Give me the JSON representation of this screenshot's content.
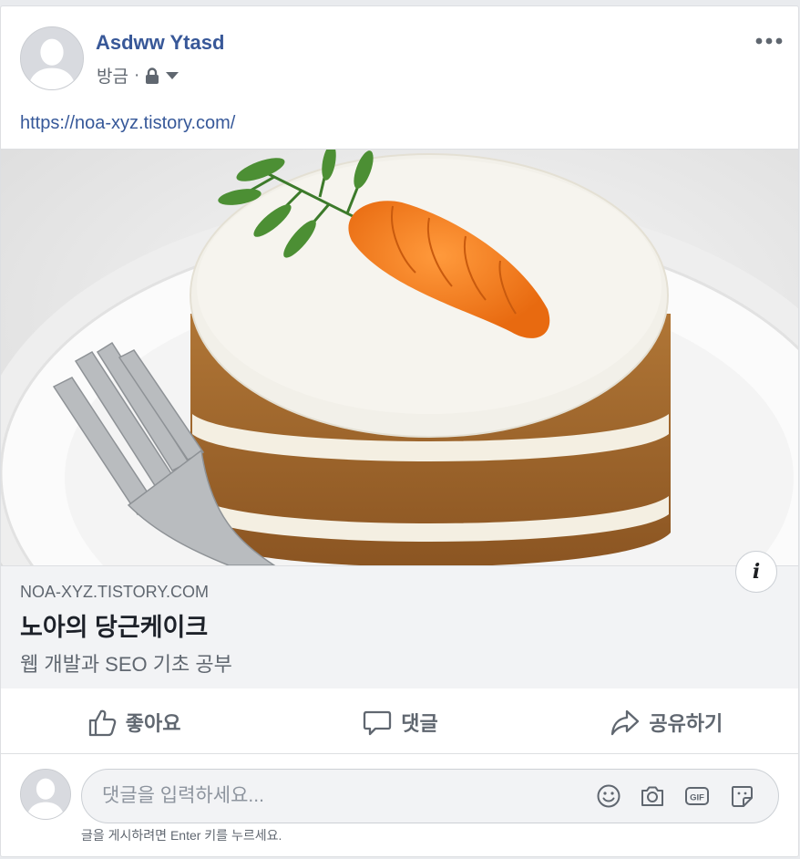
{
  "post": {
    "author": "Asdww Ytasd",
    "timestamp": "방금",
    "separator": "·",
    "privacy_icon": "lock-icon",
    "url_text": "https://noa-xyz.tistory.com/"
  },
  "link_preview": {
    "domain": "NOA-XYZ.TISTORY.COM",
    "title": "노아의 당근케이크",
    "description": "웹 개발과 SEO 기초 공부",
    "info_glyph": "i"
  },
  "actions": {
    "like_label": "좋아요",
    "comment_label": "댓글",
    "share_label": "공유하기"
  },
  "comment_composer": {
    "placeholder": "댓글을 입력하세요...",
    "hint": "글을 게시하려면 Enter 키를 누르세요.",
    "icons": [
      "emoji-icon",
      "camera-icon",
      "gif-icon",
      "sticker-icon"
    ]
  },
  "colors": {
    "author_link": "#385898",
    "url_link": "#365899",
    "muted_text": "#606770",
    "preview_background": "#f2f3f5"
  }
}
